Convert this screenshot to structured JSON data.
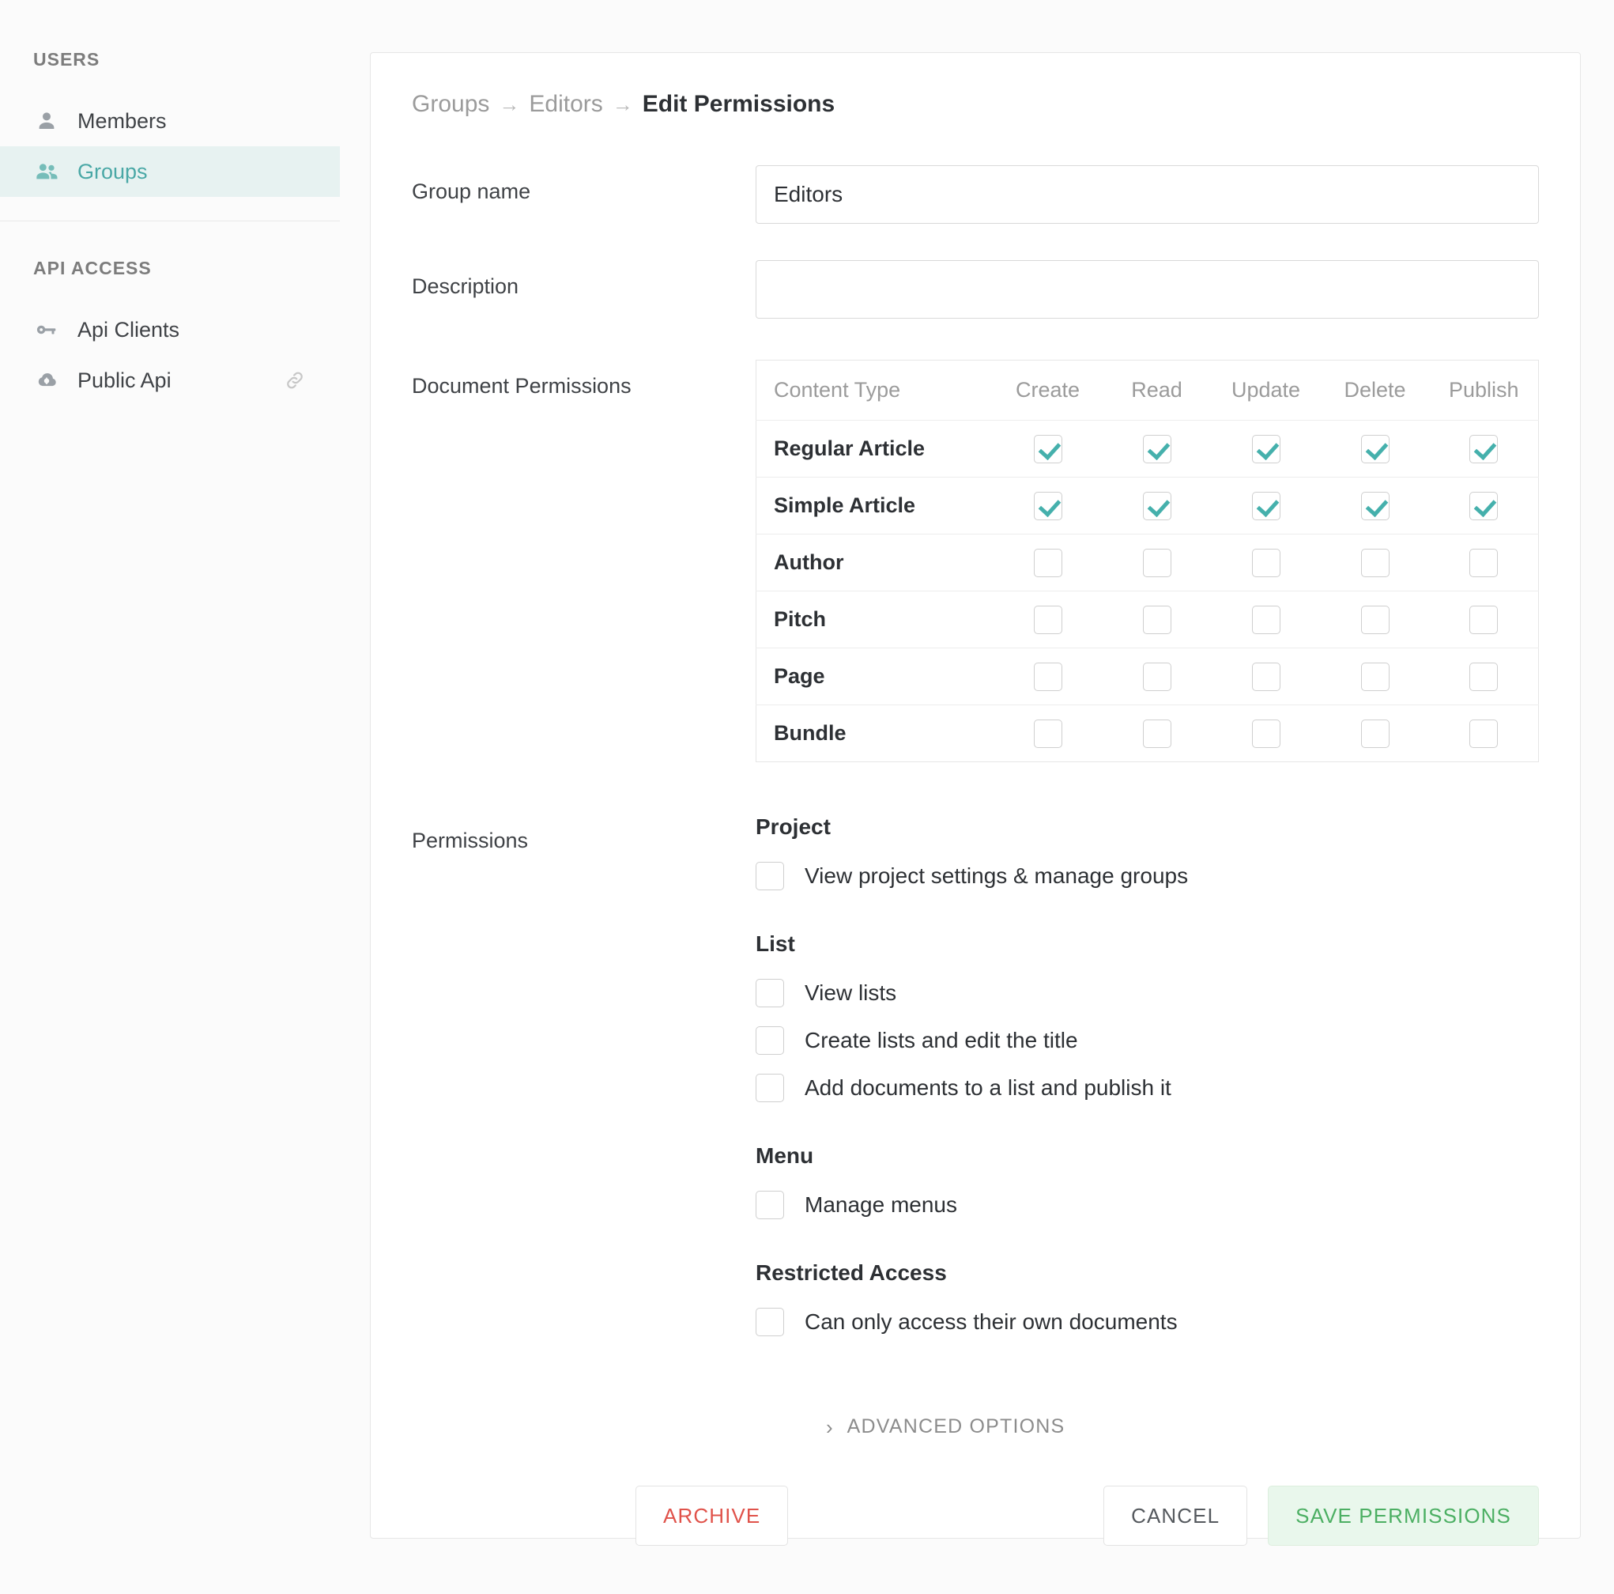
{
  "sidebar": {
    "sections": [
      {
        "title": "USERS",
        "items": [
          {
            "label": "Members",
            "icon": "person-icon",
            "active": false,
            "trailing_icon": null
          },
          {
            "label": "Groups",
            "icon": "people-icon",
            "active": true,
            "trailing_icon": null
          }
        ]
      },
      {
        "title": "API ACCESS",
        "items": [
          {
            "label": "Api Clients",
            "icon": "key-icon",
            "active": false,
            "trailing_icon": null
          },
          {
            "label": "Public Api",
            "icon": "cloud-api-icon",
            "active": false,
            "trailing_icon": "link-icon"
          }
        ]
      }
    ]
  },
  "breadcrumb": {
    "items": [
      "Groups",
      "Editors",
      "Edit Permissions"
    ],
    "separator": "→"
  },
  "form": {
    "group_name_label": "Group name",
    "group_name_value": "Editors",
    "group_name_placeholder": "",
    "description_label": "Description",
    "description_value": "",
    "description_placeholder": "",
    "document_permissions_label": "Document Permissions",
    "permissions_label": "Permissions"
  },
  "document_permissions": {
    "columns": [
      "Content Type",
      "Create",
      "Read",
      "Update",
      "Delete",
      "Publish"
    ],
    "rows": [
      {
        "name": "Regular Article",
        "create": true,
        "read": true,
        "update": true,
        "delete": true,
        "publish": true
      },
      {
        "name": "Simple Article",
        "create": true,
        "read": true,
        "update": true,
        "delete": true,
        "publish": true
      },
      {
        "name": "Author",
        "create": false,
        "read": false,
        "update": false,
        "delete": false,
        "publish": false
      },
      {
        "name": "Pitch",
        "create": false,
        "read": false,
        "update": false,
        "delete": false,
        "publish": false
      },
      {
        "name": "Page",
        "create": false,
        "read": false,
        "update": false,
        "delete": false,
        "publish": false
      },
      {
        "name": "Bundle",
        "create": false,
        "read": false,
        "update": false,
        "delete": false,
        "publish": false
      }
    ]
  },
  "permission_groups": [
    {
      "title": "Project",
      "options": [
        {
          "label": "View project settings & manage groups",
          "checked": false
        }
      ]
    },
    {
      "title": "List",
      "options": [
        {
          "label": "View lists",
          "checked": false
        },
        {
          "label": "Create lists and edit the title",
          "checked": false
        },
        {
          "label": "Add documents to a list and publish it",
          "checked": false
        }
      ]
    },
    {
      "title": "Menu",
      "options": [
        {
          "label": "Manage menus",
          "checked": false
        }
      ]
    },
    {
      "title": "Restricted Access",
      "options": [
        {
          "label": "Can only access their own documents",
          "checked": false
        }
      ]
    }
  ],
  "advanced": {
    "label": "ADVANCED OPTIONS",
    "chevron": "›",
    "expanded": false
  },
  "footer": {
    "archive_label": "ARCHIVE",
    "cancel_label": "CANCEL",
    "save_label": "SAVE PERMISSIONS"
  },
  "colors": {
    "accent_teal": "#45b0ac",
    "active_nav_bg": "#e7f2f1",
    "active_nav_text": "#4aa8a6",
    "danger_red": "#e0524a",
    "success_green": "#4caf63",
    "success_bg": "#e9f7ec",
    "page_bg": "#fbfbfb",
    "card_bg": "#ffffff",
    "border": "#e6e6e6"
  }
}
